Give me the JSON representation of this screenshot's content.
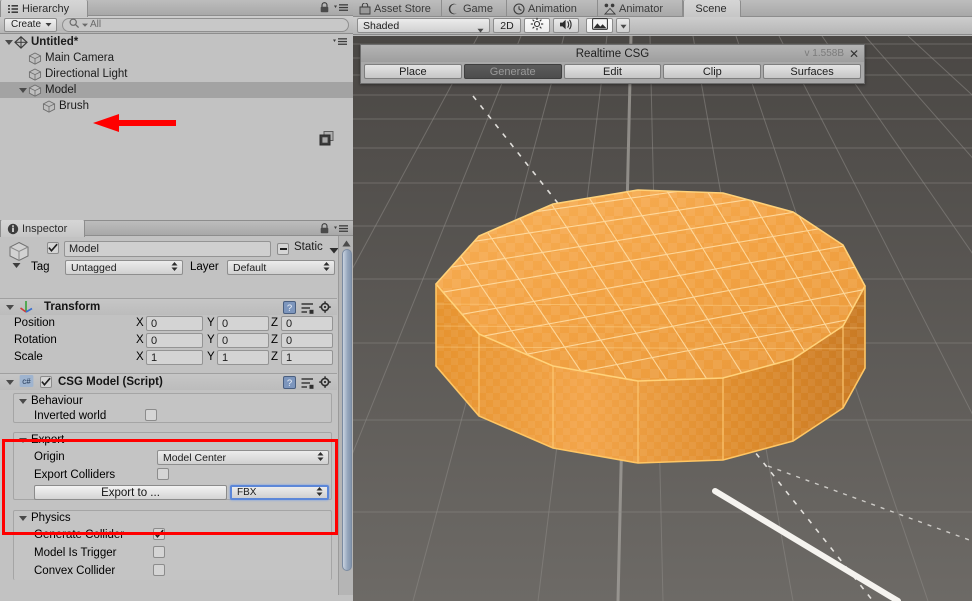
{
  "hierarchy": {
    "tab_label": "Hierarchy",
    "create_label": "Create",
    "search_placeholder": "All",
    "scene_name": "Untitled*",
    "items": [
      {
        "label": "Main Camera",
        "icon": "gameobject-cube-icon",
        "indent": 1,
        "selected": false,
        "expandable": false
      },
      {
        "label": "Directional Light",
        "icon": "gameobject-cube-icon",
        "indent": 1,
        "selected": false,
        "expandable": false
      },
      {
        "label": "Model",
        "icon": "gameobject-cube-icon",
        "indent": 1,
        "selected": true,
        "expandable": true
      },
      {
        "label": "Brush",
        "icon": "gameobject-cube-icon",
        "indent": 2,
        "selected": false,
        "expandable": false
      }
    ]
  },
  "inspector": {
    "tab_label": "Inspector",
    "object_name": "Model",
    "object_enabled": true,
    "static_label": "Static",
    "tag_label": "Tag",
    "tag_value": "Untagged",
    "layer_label": "Layer",
    "layer_value": "Default",
    "transform": {
      "title": "Transform",
      "rows": [
        {
          "label": "Position",
          "x": "0",
          "y": "0",
          "z": "0"
        },
        {
          "label": "Rotation",
          "x": "0",
          "y": "0",
          "z": "0"
        },
        {
          "label": "Scale",
          "x": "1",
          "y": "1",
          "z": "1"
        }
      ],
      "axis_labels": [
        "X",
        "Y",
        "Z"
      ]
    },
    "csg_model": {
      "title": "CSG Model (Script)",
      "enabled": true,
      "script_badge": "c#",
      "behaviour": {
        "title": "Behaviour",
        "inverted_world_label": "Inverted world",
        "inverted_world_checked": false
      },
      "export": {
        "title": "Export",
        "origin_label": "Origin",
        "origin_value": "Model Center",
        "export_colliders_label": "Export Colliders",
        "export_colliders_checked": false,
        "export_button_label": "Export to ...",
        "format_value": "FBX",
        "highlight_color": "#ff0000"
      },
      "physics": {
        "title": "Physics",
        "rows": [
          {
            "label": "Generate Collider",
            "checked": true
          },
          {
            "label": "Model Is Trigger",
            "checked": false
          },
          {
            "label": "Convex Collider",
            "checked": false
          }
        ]
      }
    }
  },
  "scene_tabs": [
    {
      "label": "Asset Store",
      "icon": "asset-store-icon",
      "active": false
    },
    {
      "label": "Game",
      "icon": "game-controller-icon",
      "active": false
    },
    {
      "label": "Animation",
      "icon": "clock-icon",
      "active": false
    },
    {
      "label": "Animator",
      "icon": "animator-icon",
      "active": false
    },
    {
      "label": "Scene",
      "icon": "scene-icon",
      "active": true
    }
  ],
  "scene_toolbar": {
    "draw_mode": "Shaded",
    "two_d_label": "2D",
    "lighting_icon": "sun-icon",
    "audio_icon": "speaker-icon",
    "effects_icon": "image-icon",
    "effects_dropdown_icon": "chevron-down-icon"
  },
  "csg_window": {
    "title": "Realtime CSG",
    "version": "v 1.558B",
    "close_icon": "close-icon",
    "tabs": [
      {
        "label": "Place",
        "active": false
      },
      {
        "label": "Generate",
        "active": true
      },
      {
        "label": "Edit",
        "active": false
      },
      {
        "label": "Clip",
        "active": false
      },
      {
        "label": "Surfaces",
        "active": false
      }
    ]
  },
  "scene_colors": {
    "background": "#4d4a47",
    "grid_line": "#8b8884",
    "model_fill": "#f0a243",
    "model_edge": "#ffd27a",
    "axis_line": "#f2f0ec",
    "annotation_arrow": "#ff0000"
  }
}
